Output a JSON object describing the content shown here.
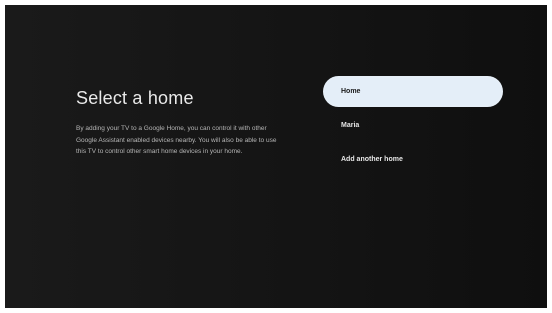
{
  "screen": {
    "title": "Select a home",
    "description": "By adding your TV to a Google Home, you can control it with other Google Assistant enabled devices nearby. You will also be able to use this TV to control other smart home devices in your home."
  },
  "options": [
    {
      "label": "Home",
      "selected": true
    },
    {
      "label": "Maria",
      "selected": false
    },
    {
      "label": "Add another home",
      "selected": false
    }
  ]
}
